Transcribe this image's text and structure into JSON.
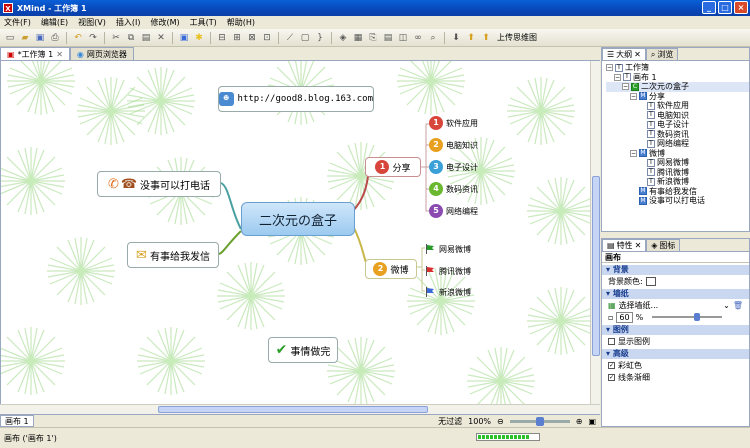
{
  "window": {
    "title": "XMind - 工作簿 1",
    "app_icon": "xmind-logo-icon"
  },
  "menu": [
    "文件(F)",
    "编辑(E)",
    "视图(V)",
    "插入(I)",
    "修改(M)",
    "工具(T)",
    "帮助(H)"
  ],
  "toolbar": {
    "upload_label": "上传思维图"
  },
  "editor_tabs": [
    {
      "label": "*工作簿 1"
    },
    {
      "label": "网页浏览器"
    }
  ],
  "mindmap": {
    "central": "二次元の盒子",
    "url_topic": "http://good8.blog.163.com",
    "left_topics": [
      "没事可以打电话",
      "有事给我发信",
      "事情做完"
    ],
    "branches": [
      {
        "label": "分享",
        "number": "1",
        "children": [
          {
            "number": "1",
            "label": "软件应用",
            "color": "#d8453a"
          },
          {
            "number": "2",
            "label": "电脑知识",
            "color": "#e8a020"
          },
          {
            "number": "3",
            "label": "电子设计",
            "color": "#3aa0d8"
          },
          {
            "number": "4",
            "label": "数码资讯",
            "color": "#6ab830"
          },
          {
            "number": "5",
            "label": "网络编程",
            "color": "#8a4ab0"
          }
        ]
      },
      {
        "label": "微博",
        "number": "2",
        "children": [
          {
            "label": "网易微博",
            "flag_color": "#2a9a2a"
          },
          {
            "label": "腾讯微博",
            "flag_color": "#d83030"
          },
          {
            "label": "新浪微博",
            "flag_color": "#3a6ad8"
          }
        ]
      }
    ]
  },
  "sheet_tab": "画布 1",
  "zoom": {
    "filter": "无过滤",
    "level": "100%"
  },
  "status_text": "画布 ('画布 1')",
  "progress_fraction": 0.85,
  "outline_panel": {
    "tabs": [
      "大纲",
      "浏览"
    ],
    "tree": [
      {
        "level": 0,
        "type": "T",
        "label": "工作簿"
      },
      {
        "level": 1,
        "type": "T",
        "label": "画布 1"
      },
      {
        "level": 2,
        "type": "C",
        "label": "二次元の盒子"
      },
      {
        "level": 3,
        "type": "M",
        "label": "分享"
      },
      {
        "level": 4,
        "type": "T",
        "label": "软件应用"
      },
      {
        "level": 4,
        "type": "T",
        "label": "电脑知识"
      },
      {
        "level": 4,
        "type": "T",
        "label": "电子设计"
      },
      {
        "level": 4,
        "type": "T",
        "label": "数码资讯"
      },
      {
        "level": 4,
        "type": "T",
        "label": "网络编程"
      },
      {
        "level": 3,
        "type": "M",
        "label": "微博"
      },
      {
        "level": 4,
        "type": "T",
        "label": "网易微博"
      },
      {
        "level": 4,
        "type": "T",
        "label": "腾讯微博"
      },
      {
        "level": 4,
        "type": "T",
        "label": "新浪微博"
      },
      {
        "level": 3,
        "type": "M",
        "label": "有事给我发信"
      },
      {
        "level": 3,
        "type": "M",
        "label": "没事可以打电话"
      }
    ]
  },
  "props_panel": {
    "tabs": [
      "特性",
      "图标"
    ],
    "header": "画布",
    "sections": {
      "background": "背景",
      "bg_color_label": "背景颜色:",
      "wallpaper": "墙纸",
      "wallpaper_select": "选择墙纸...",
      "opacity_value": "60",
      "opacity_unit": "%",
      "legend": "图例",
      "show_legend": "显示图例",
      "advanced": "高级",
      "rainbow": "彩虹色",
      "taper": "线条渐细"
    }
  }
}
